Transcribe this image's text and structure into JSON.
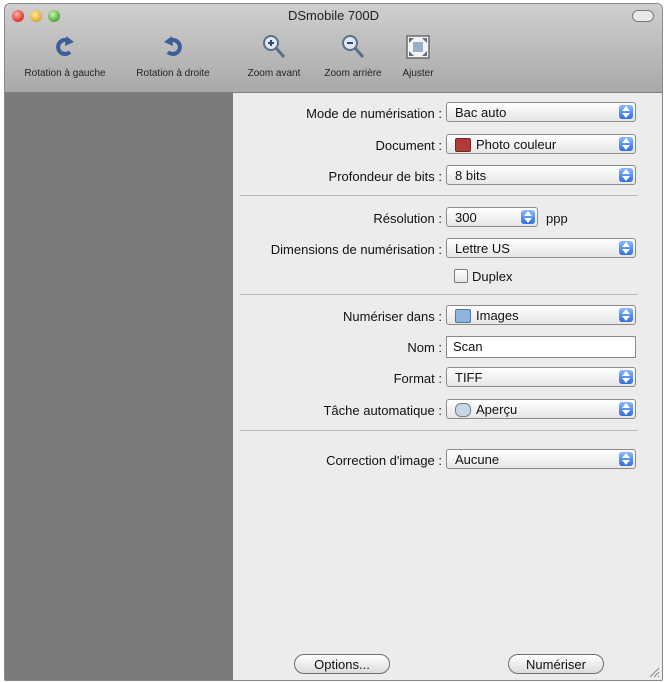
{
  "window": {
    "title": "DSmobile 700D"
  },
  "toolbar": {
    "rotate_left": "Rotation à gauche",
    "rotate_right": "Rotation à droite",
    "zoom_in": "Zoom avant",
    "zoom_out": "Zoom arrière",
    "fit": "Ajuster"
  },
  "form": {
    "scan_mode": {
      "label": "Mode de numérisation :",
      "value": "Bac auto"
    },
    "document": {
      "label": "Document :",
      "value": "Photo couleur",
      "icon": "photo-icon"
    },
    "bit_depth": {
      "label": "Profondeur de bits :",
      "value": "8 bits"
    },
    "resolution": {
      "label": "Résolution :",
      "value": "300",
      "unit": "ppp"
    },
    "scan_size": {
      "label": "Dimensions de numérisation :",
      "value": "Lettre US"
    },
    "duplex": {
      "label": "Duplex",
      "checked": false
    },
    "scan_to": {
      "label": "Numériser dans :",
      "value": "Images",
      "icon": "folder-icon"
    },
    "name": {
      "label": "Nom :",
      "value": "Scan"
    },
    "format": {
      "label": "Format :",
      "value": "TIFF"
    },
    "auto_task": {
      "label": "Tâche automatique :",
      "value": "Aperçu",
      "icon": "preview-app-icon"
    },
    "image_correction": {
      "label": "Correction d'image :",
      "value": "Aucune"
    }
  },
  "buttons": {
    "options": "Options...",
    "scan": "Numériser"
  },
  "colors": {
    "sidebar": "#7b7b7b",
    "panel": "#ececec",
    "popup_arrows": "#2f6fe0"
  }
}
